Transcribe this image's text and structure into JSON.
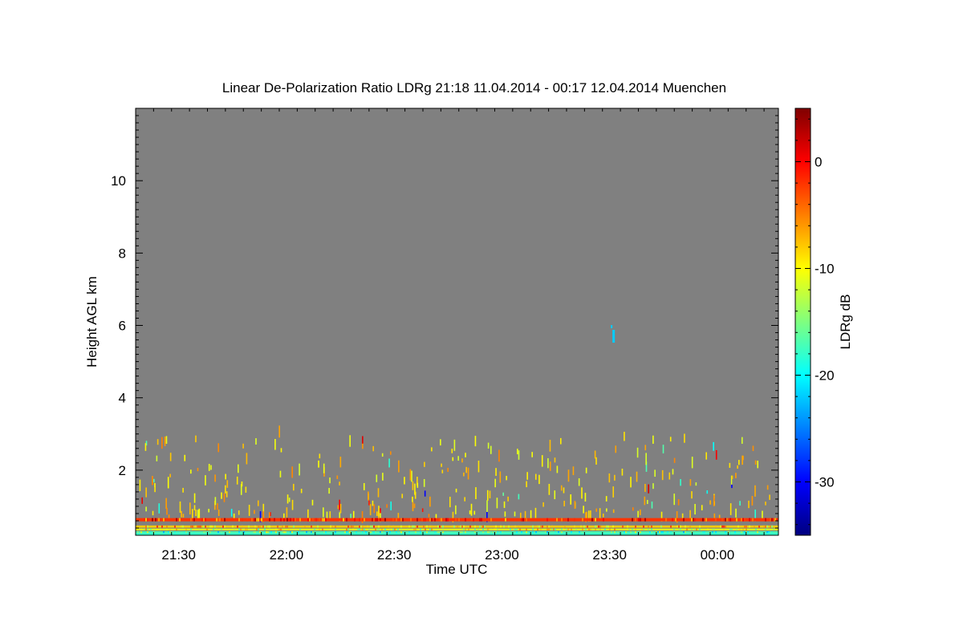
{
  "chart_data": {
    "type": "heatmap",
    "title": "Linear De-Polarization Ratio LDRg   21:18 11.04.2014 - 00:17 12.04.2014 Muenchen",
    "xlabel": "Time UTC",
    "ylabel": "Height AGL km",
    "x_range_minutes_since_midnight": [
      1278,
      1457
    ],
    "x_tick_labels": [
      "21:30",
      "22:00",
      "22:30",
      "23:00",
      "23:30",
      "00:00"
    ],
    "x_tick_minutes": [
      1290,
      1320,
      1350,
      1380,
      1410,
      1440
    ],
    "ylim_km": [
      0.2,
      12.0
    ],
    "y_ticks_km": [
      2,
      4,
      6,
      8,
      10
    ],
    "background_color": "#808080",
    "colorbar": {
      "label": "LDRg dB",
      "range_db": [
        -35,
        5
      ],
      "ticks_db": [
        0,
        -10,
        -20,
        -30
      ],
      "colors": [
        "#00007f",
        "#0000ff",
        "#007fff",
        "#00ffff",
        "#7fff7f",
        "#ffff00",
        "#ff7f00",
        "#ff0000",
        "#7f0000"
      ]
    },
    "bands": [
      {
        "height_km": 0.63,
        "thickness_km": 0.09,
        "ldr_db": -2
      },
      {
        "height_km": 0.44,
        "thickness_km": 0.06,
        "ldr_db": -8
      },
      {
        "height_km": 0.36,
        "thickness_km": 0.05,
        "ldr_db": -11
      },
      {
        "height_km": 0.28,
        "thickness_km": 0.06,
        "ldr_db": -17
      }
    ],
    "features": [
      {
        "time_min": 1411,
        "height_km": 5.7,
        "ldr_db": -22,
        "note": "isolated echo"
      }
    ],
    "scatter_summary": {
      "height_range_km": [
        0.7,
        3.5
      ],
      "dominant_ldr_db": [
        -12,
        -5
      ]
    }
  }
}
